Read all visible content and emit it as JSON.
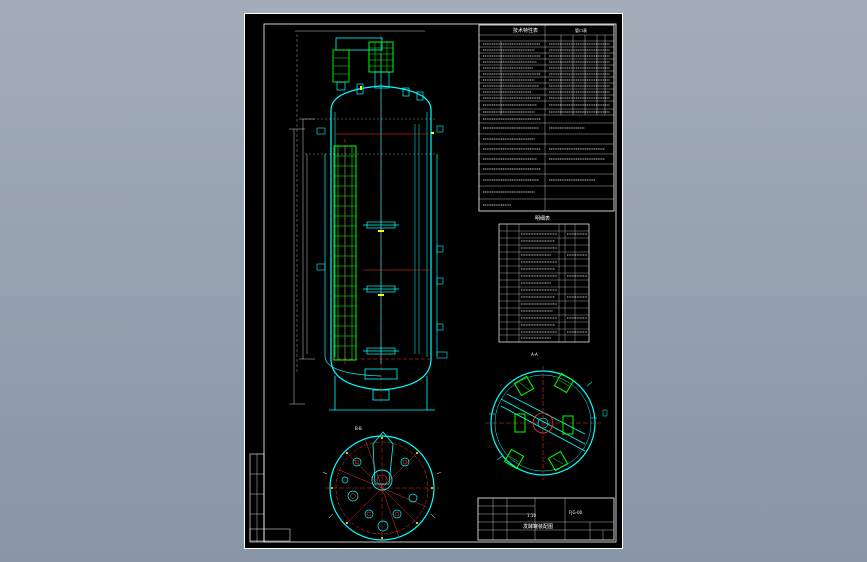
{
  "sheet": {
    "tech_table_title": "技术特性表",
    "tech_table_header": "管口表",
    "parts_table_title": "明细表",
    "section_label_top": "A-A",
    "section_label_bottom": "B-B",
    "drawing_name": "发酵罐装配图",
    "scale_label": "1:10",
    "drawing_code": "FJG-00"
  },
  "colors": {
    "frame": "#ffffff",
    "vessel": "#00ffff",
    "coil": "#00ff00",
    "centerline": "#ff3333",
    "accent": "#ffff00"
  }
}
